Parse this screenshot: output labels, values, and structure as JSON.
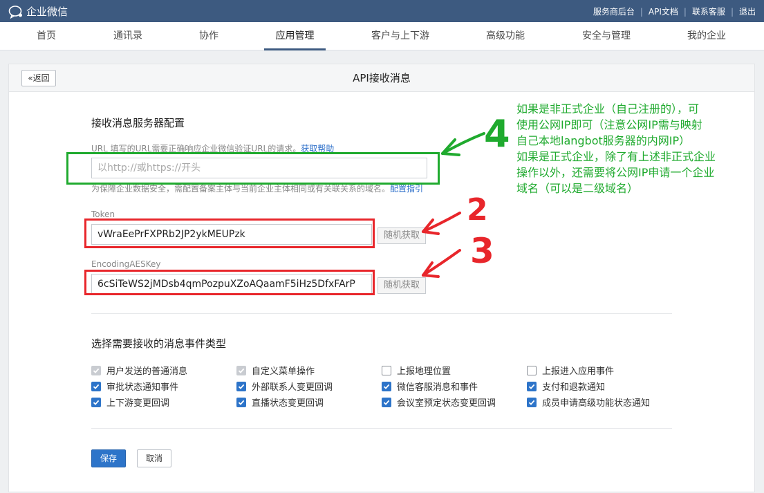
{
  "topbar": {
    "brand": "企业微信",
    "links": [
      "服务商后台",
      "API文档",
      "联系客服",
      "退出"
    ]
  },
  "nav": {
    "tabs": [
      "首页",
      "通讯录",
      "协作",
      "应用管理",
      "客户与上下游",
      "高级功能",
      "安全与管理",
      "我的企业"
    ],
    "active": "应用管理"
  },
  "page": {
    "back_label": "返回",
    "title": "API接收消息"
  },
  "server_config": {
    "section_title": "接收消息服务器配置",
    "url_hint": "URL 填写的URL需要正确响应企业微信验证URL的请求。",
    "url_help_link": "获取帮助",
    "url_placeholder": "以http://或https://开头",
    "url_value": "",
    "domain_hint": "为保障企业数据安全，需配置备案主体与当前企业主体相同或有关联关系的域名。",
    "domain_guide_link": "配置指引",
    "token_label": "Token",
    "token_value": "vWraEePrFXPRb2JP2ykMEUPzk",
    "aes_label": "EncodingAESKey",
    "aes_value": "6cSiTeWS2jMDsb4qmPozpuXZoAQaamF5iHz5DfxFArP",
    "random_label": "随机获取"
  },
  "events": {
    "section_title": "选择需要接收的消息事件类型",
    "items": [
      {
        "label": "用户发送的普通消息",
        "state": "disabled"
      },
      {
        "label": "自定义菜单操作",
        "state": "disabled"
      },
      {
        "label": "上报地理位置",
        "state": "unchecked"
      },
      {
        "label": "上报进入应用事件",
        "state": "unchecked"
      },
      {
        "label": "审批状态通知事件",
        "state": "checked"
      },
      {
        "label": "外部联系人变更回调",
        "state": "checked"
      },
      {
        "label": "微信客服消息和事件",
        "state": "checked"
      },
      {
        "label": "支付和退款通知",
        "state": "checked"
      },
      {
        "label": "上下游变更回调",
        "state": "checked"
      },
      {
        "label": "直播状态变更回调",
        "state": "checked"
      },
      {
        "label": "会议室预定状态变更回调",
        "state": "checked"
      },
      {
        "label": "成员申请高级功能状态通知",
        "state": "checked"
      }
    ]
  },
  "actions": {
    "save_label": "保存",
    "cancel_label": "取消"
  },
  "annotations": {
    "numbers": [
      "4",
      "2",
      "3"
    ],
    "note_lines": [
      "如果是非正式企业（自己注册的），可",
      "使用公网IP即可（注意公网IP需与映射",
      "自己本地langbot服务器的内网IP）",
      "如果是正式企业，除了有上述非正式企业",
      "操作以外，还需要将公网IP申请一个企业",
      "域名（可以是二级域名）"
    ],
    "green_color": "#1faa2e",
    "red_color": "#e8262b"
  },
  "colors": {
    "topbar": "#3d5a80",
    "link": "#2b6ec9",
    "primary_button": "#2d74c9"
  }
}
